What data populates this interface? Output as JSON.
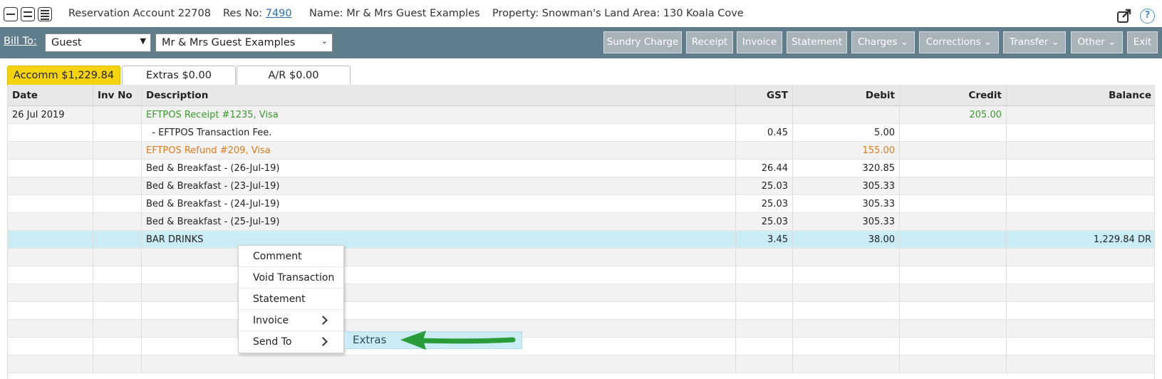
{
  "header": {
    "account": "Reservation Account 22708",
    "res_no_label": "Res No:",
    "res_no": "7490",
    "name": "Name: Mr & Mrs Guest Examples",
    "property": "Property: Snowman's Land",
    "area": "Area: 130 Koala Cove",
    "help": "?"
  },
  "toolbar": {
    "bill_to_label": "Bill To:",
    "bill_to_type": "Guest",
    "bill_to_name": "Mr & Mrs Guest Examples",
    "buttons": {
      "sundry": "Sundry Charge",
      "receipt": "Receipt",
      "invoice": "Invoice",
      "statement": "Statement",
      "charges": "Charges",
      "corrections": "Corrections",
      "transfer": "Transfer",
      "other": "Other",
      "exit": "Exit"
    }
  },
  "tabs": [
    {
      "label": "Accomm $1,229.84",
      "active": true
    },
    {
      "label": "Extras $0.00",
      "active": false
    },
    {
      "label": "A/R $0.00",
      "active": false
    }
  ],
  "table": {
    "headers": {
      "date": "Date",
      "inv": "Inv No",
      "desc": "Description",
      "gst": "GST",
      "debit": "Debit",
      "credit": "Credit",
      "balance": "Balance"
    },
    "rows": [
      {
        "date": "26 Jul 2019",
        "inv": "",
        "desc": "EFTPOS Receipt #1235, Visa",
        "gst": "",
        "debit": "",
        "credit": "205.00",
        "balance": ""
      },
      {
        "date": "",
        "inv": "",
        "desc": "  - EFTPOS Transaction Fee.",
        "gst": "0.45",
        "debit": "5.00",
        "credit": "",
        "balance": ""
      },
      {
        "date": "",
        "inv": "",
        "desc": "EFTPOS Refund #209, Visa",
        "gst": "",
        "debit": "155.00",
        "credit": "",
        "balance": ""
      },
      {
        "date": "",
        "inv": "",
        "desc": "Bed & Breakfast - (26-Jul-19)",
        "gst": "26.44",
        "debit": "320.85",
        "credit": "",
        "balance": ""
      },
      {
        "date": "",
        "inv": "",
        "desc": "Bed & Breakfast - (23-Jul-19)",
        "gst": "25.03",
        "debit": "305.33",
        "credit": "",
        "balance": ""
      },
      {
        "date": "",
        "inv": "",
        "desc": "Bed & Breakfast - (24-Jul-19)",
        "gst": "25.03",
        "debit": "305.33",
        "credit": "",
        "balance": ""
      },
      {
        "date": "",
        "inv": "",
        "desc": "Bed & Breakfast - (25-Jul-19)",
        "gst": "25.03",
        "debit": "305.33",
        "credit": "",
        "balance": ""
      },
      {
        "date": "",
        "inv": "",
        "desc": "BAR DRINKS",
        "gst": "3.45",
        "debit": "38.00",
        "credit": "",
        "balance": "1,229.84 DR"
      }
    ]
  },
  "context_menu": {
    "items": [
      "Comment",
      "Void Transaction",
      "Statement",
      "Invoice",
      "Send To"
    ],
    "submenu_item": "Extras"
  },
  "colors": {
    "toolbar_bg": "#607d8b",
    "active_tab": "#f5d40f",
    "selected_row": "#c9ecf5",
    "receipt_green": "#3a9a2c",
    "refund_orange": "#e07b1a",
    "arrow_green": "#2a9d3a"
  }
}
